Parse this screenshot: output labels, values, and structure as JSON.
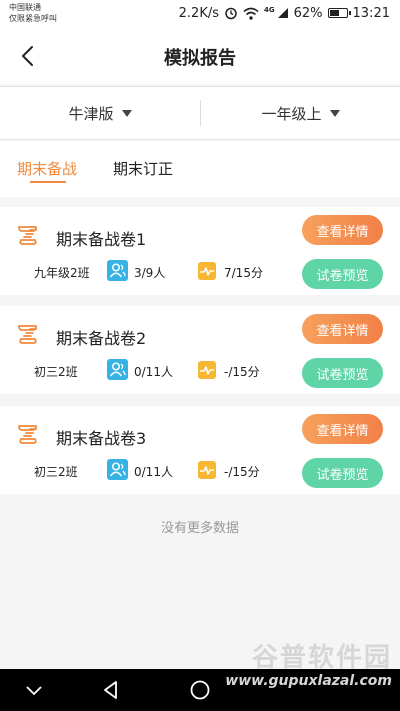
{
  "status_bar": {
    "carrier_line1": "中国联通",
    "carrier_line2": "仅限紧急呼叫",
    "network_speed": "2.2K/s",
    "signal_badge": "4G",
    "battery": "62%",
    "battery_level": 0.62,
    "time": "13:21"
  },
  "header": {
    "title": "模拟报告"
  },
  "filters": [
    {
      "label": "牛津版"
    },
    {
      "label": "一年级上"
    }
  ],
  "tabs": [
    {
      "label": "期末备战",
      "active": true
    },
    {
      "label": "期末订正",
      "active": false
    }
  ],
  "cards": [
    {
      "title": "期末备战卷1",
      "class_name": "九年级2班",
      "people": "3/9人",
      "score": "7/15分",
      "detail_label": "查看详情",
      "preview_label": "试卷预览"
    },
    {
      "title": "期末备战卷2",
      "class_name": "初三2班",
      "people": "0/11人",
      "score": "-/15分",
      "detail_label": "查看详情",
      "preview_label": "试卷预览"
    },
    {
      "title": "期末备战卷3",
      "class_name": "初三2班",
      "people": "0/11人",
      "score": "-/15分",
      "detail_label": "查看详情",
      "preview_label": "试卷预览"
    }
  ],
  "footer": {
    "no_more": "没有更多数据"
  },
  "watermark": {
    "title": "谷普软件园",
    "url": "www.gupuxlazal.com"
  },
  "colors": {
    "accent": "#f08a3c",
    "detail_button": "#f28048",
    "preview_button": "#5fd4a6",
    "people_icon": "#36b2e5",
    "score_icon": "#f7b733"
  }
}
